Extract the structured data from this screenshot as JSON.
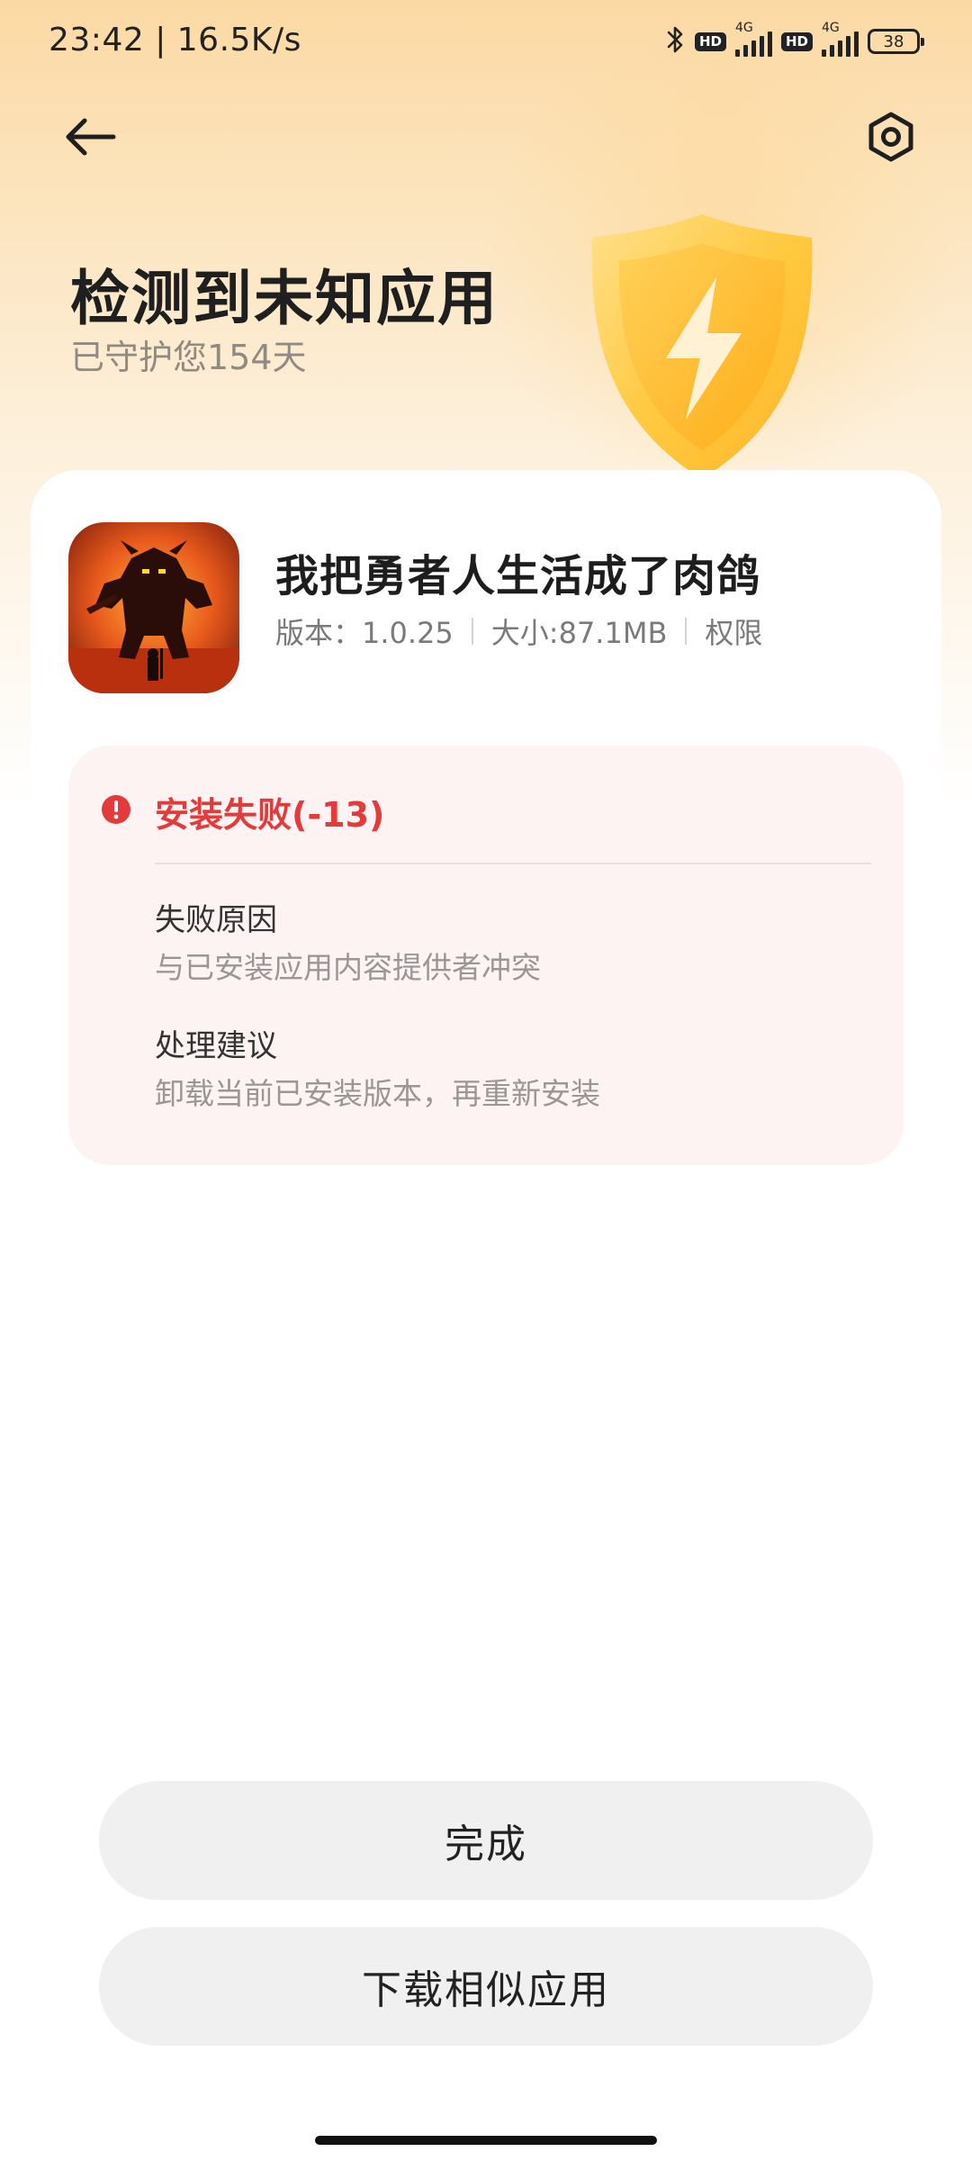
{
  "status_bar": {
    "time_speed": "23:42 | 16.5K/s",
    "hd_1": "HD",
    "net_1": "4G",
    "hd_2": "HD",
    "net_2": "4G",
    "battery": "38"
  },
  "header": {
    "back_icon": "back-arrow-icon",
    "settings_icon": "settings-gear-icon",
    "title": "检测到未知应用",
    "subtitle": "已守护您154天"
  },
  "app": {
    "name": "我把勇者人生活成了肉鸽",
    "version": "版本：1.0.25",
    "size": "大小:87.1MB",
    "permissions_label": "权限"
  },
  "error": {
    "title": "安装失败(-13)",
    "reason_label": "失败原因",
    "reason_value": "与已安装应用内容提供者冲突",
    "suggestion_label": "处理建议",
    "suggestion_value": "卸载当前已安装版本，再重新安装",
    "accent_color": "#e33b3b"
  },
  "actions": {
    "done_label": "完成",
    "download_similar_label": "下载相似应用"
  },
  "colors": {
    "header_gradient_top": "#fbd9a4",
    "error_bg": "#fdf3f3",
    "button_bg": "#f0f0f0"
  }
}
